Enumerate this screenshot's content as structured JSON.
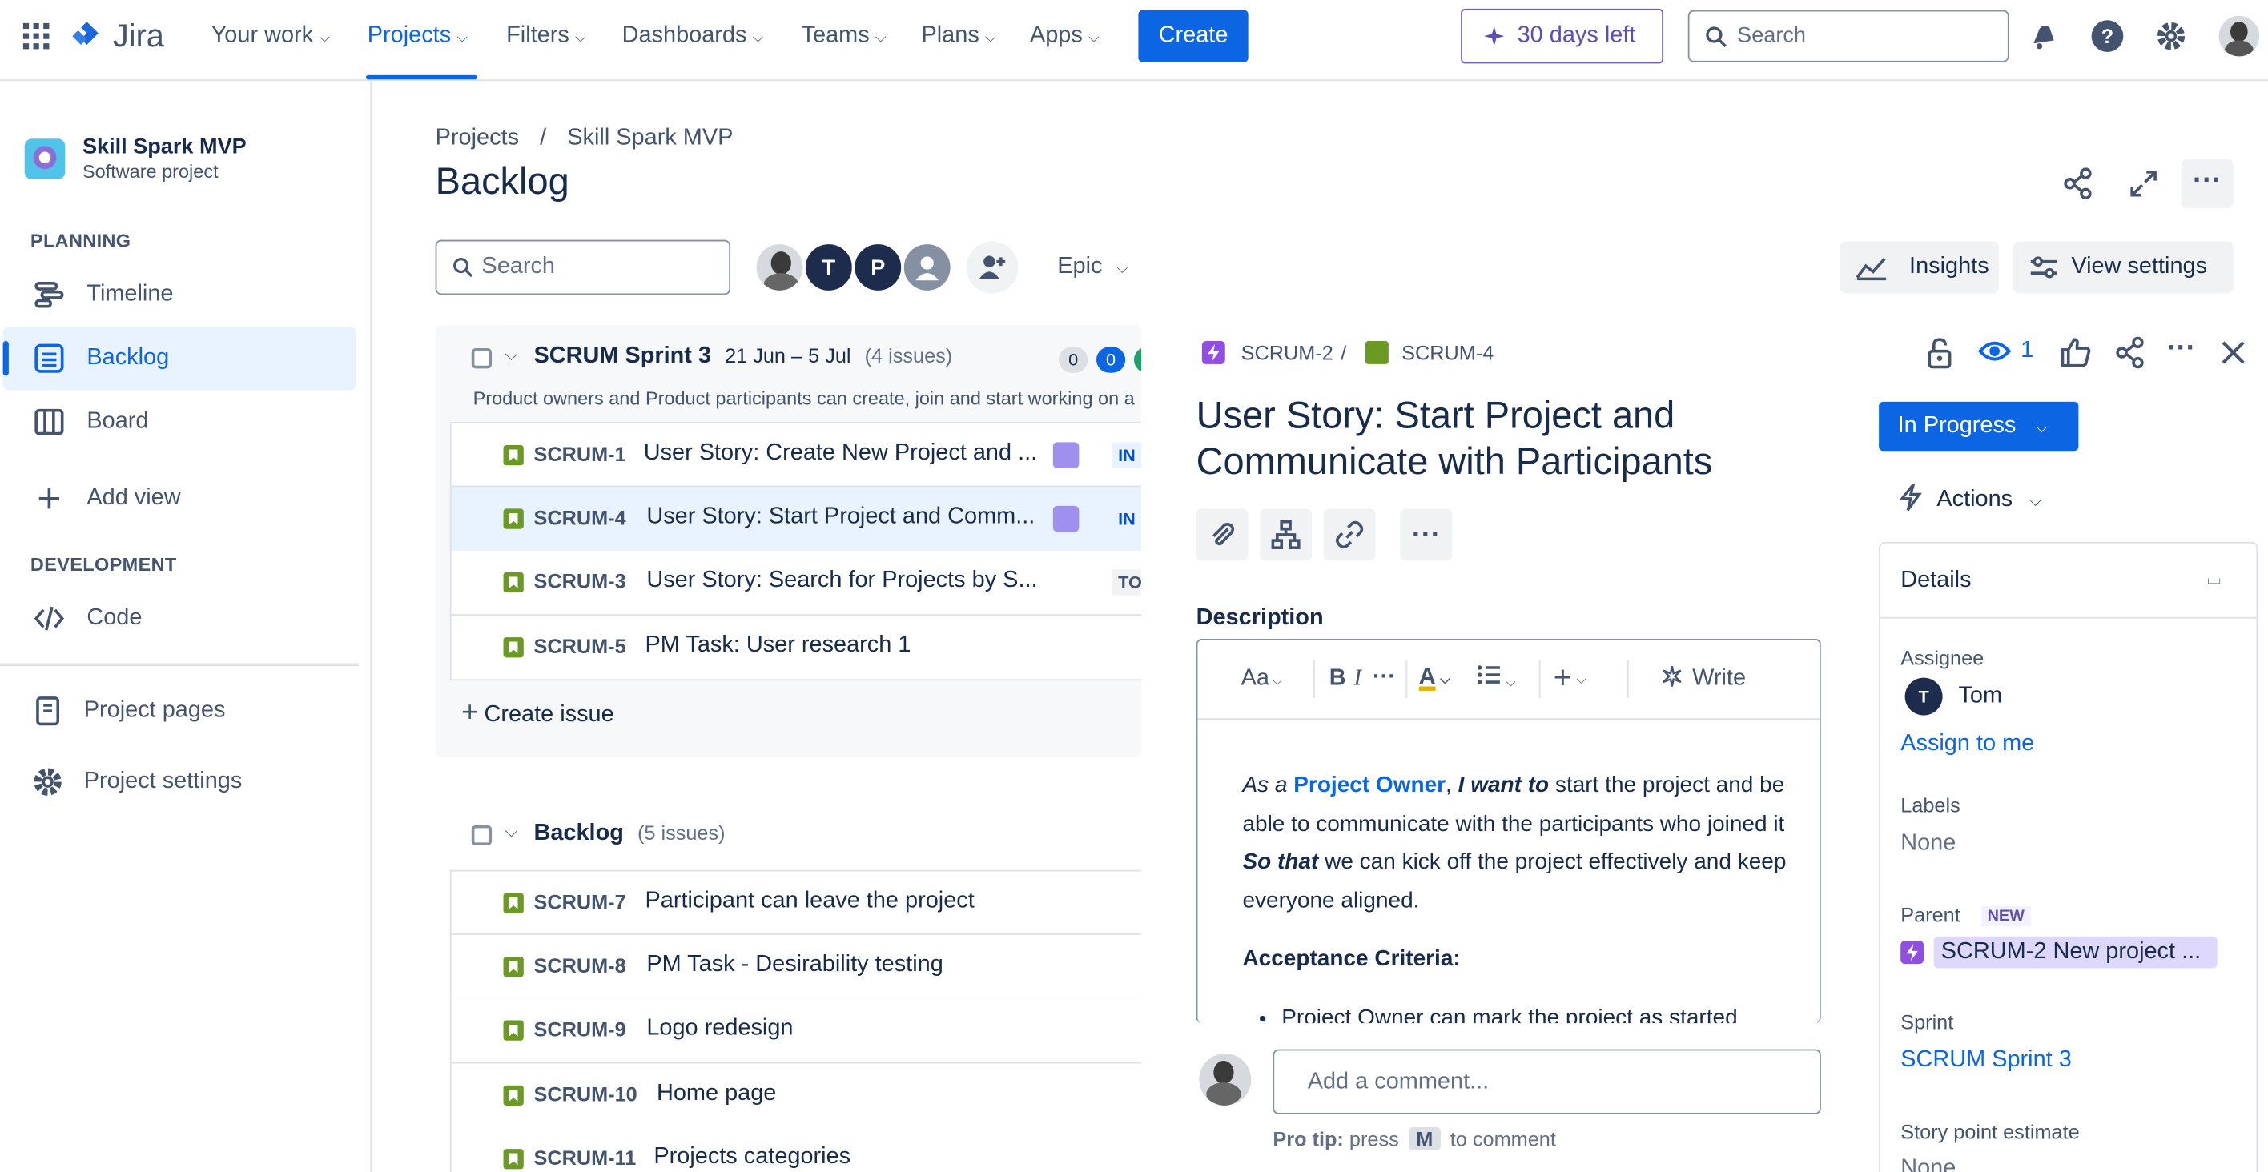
{
  "nav": {
    "app_name": "Jira",
    "items": [
      "Your work",
      "Projects",
      "Filters",
      "Dashboards",
      "Teams",
      "Plans",
      "Apps"
    ],
    "create_label": "Create",
    "trial_label": "30 days left",
    "search_placeholder": "Search"
  },
  "sidebar": {
    "project_name": "Skill Spark MVP",
    "project_type": "Software project",
    "planning_label": "PLANNING",
    "timeline": "Timeline",
    "backlog": "Backlog",
    "board": "Board",
    "add_view": "Add view",
    "development_label": "DEVELOPMENT",
    "code": "Code",
    "project_pages": "Project pages",
    "project_settings": "Project settings"
  },
  "main": {
    "breadcrumb_projects": "Projects",
    "breadcrumb_sep": "/",
    "breadcrumb_project": "Skill Spark MVP",
    "title": "Backlog",
    "search_placeholder": "Search",
    "avatars": [
      "T",
      "P"
    ],
    "epic_filter": "Epic",
    "insights": "Insights",
    "view_settings": "View settings",
    "sprint": {
      "name": "SCRUM Sprint 3",
      "dates": "21 Jun – 5 Jul",
      "count": "(4 issues)",
      "badge_todo": "0",
      "badge_inprogress": "0",
      "note": "Product owners and Product participants can create, join and start working on a",
      "issues": [
        {
          "key": "SCRUM-1",
          "summary": "User Story: Create New Project and ...",
          "status": "IN P"
        },
        {
          "key": "SCRUM-4",
          "summary": "User Story: Start Project and Comm...",
          "status": "IN P"
        },
        {
          "key": "SCRUM-3",
          "summary": "User Story: Search for Projects by S...",
          "status": "TO"
        },
        {
          "key": "SCRUM-5",
          "summary": "PM Task: User research 1",
          "status": ""
        }
      ],
      "create_issue": "Create issue"
    },
    "backlog": {
      "name": "Backlog",
      "count": "(5 issues)",
      "issues": [
        {
          "key": "SCRUM-7",
          "summary": "Participant can leave the project"
        },
        {
          "key": "SCRUM-8",
          "summary": "PM Task - Desirability testing"
        },
        {
          "key": "SCRUM-9",
          "summary": "Logo redesign"
        },
        {
          "key": "SCRUM-10",
          "summary": "Home page"
        },
        {
          "key": "SCRUM-11",
          "summary": "Projects categories"
        }
      ]
    }
  },
  "detail": {
    "parent_key": "SCRUM-2",
    "sep": "/",
    "issue_key": "SCRUM-4",
    "watch_count": "1",
    "title": "User Story: Start Project and Communicate with Participants",
    "description_label": "Description",
    "toolbar": {
      "text_style": "Aa",
      "bold": "B",
      "italic": "I",
      "more": "···",
      "text_color": "A",
      "write": "Write"
    },
    "desc": {
      "as_a": "As a",
      "role": "Project Owner",
      "comma": ",",
      "i_want_to": "I want to",
      "text1": "start the project and be able to communicate with the participants who joined it",
      "so_that": "So that",
      "text2": "we can kick off the project effectively and keep everyone aligned.",
      "acceptance_title": "Acceptance Criteria:",
      "criteria_1": "Project Owner can mark the project as started"
    },
    "comment_placeholder": "Add a comment...",
    "pro_tip_label": "Pro tip:",
    "pro_tip_press": "press",
    "pro_tip_key": "M",
    "pro_tip_rest": "to comment",
    "status": "In Progress",
    "actions": "Actions",
    "details_title": "Details",
    "assignee_label": "Assignee",
    "assignee_initial": "T",
    "assignee_name": "Tom",
    "assign_to_me": "Assign to me",
    "labels_label": "Labels",
    "labels_value": "None",
    "parent_label": "Parent",
    "parent_badge": "NEW",
    "parent_value": "SCRUM-2 New project ...",
    "sprint_label": "Sprint",
    "sprint_value": "SCRUM Sprint 3",
    "story_points_label": "Story point estimate",
    "story_points_value": "None"
  },
  "colors": {
    "brand": "#0C66E4",
    "story": "#6A9A23",
    "epic": "#9F8FEF",
    "parent_highlight": "#DFD8FD"
  }
}
